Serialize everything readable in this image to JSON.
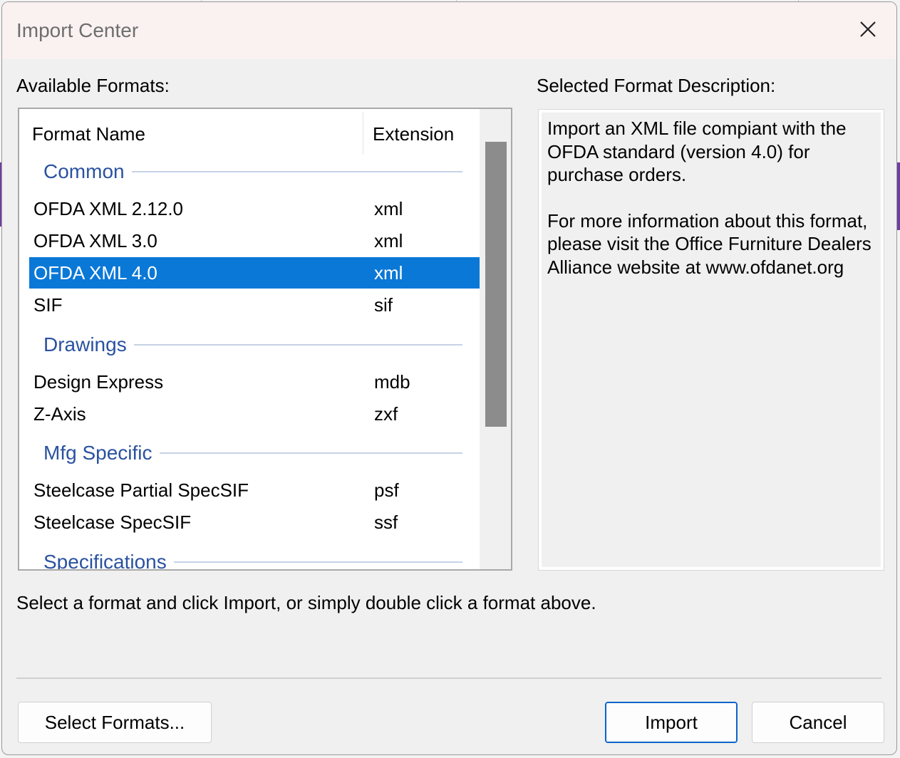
{
  "dialog": {
    "title": "Import Center"
  },
  "formats_panel": {
    "label": "Available Formats:",
    "columns": {
      "name": "Format Name",
      "extension": "Extension"
    },
    "groups": [
      {
        "name": "Common",
        "rows": [
          {
            "name": "OFDA XML 2.12.0",
            "ext": "xml",
            "selected": false
          },
          {
            "name": "OFDA XML 3.0",
            "ext": "xml",
            "selected": false
          },
          {
            "name": "OFDA XML 4.0",
            "ext": "xml",
            "selected": true
          },
          {
            "name": "SIF",
            "ext": "sif",
            "selected": false
          }
        ]
      },
      {
        "name": "Drawings",
        "rows": [
          {
            "name": "Design Express",
            "ext": "mdb",
            "selected": false
          },
          {
            "name": "Z-Axis",
            "ext": "zxf",
            "selected": false
          }
        ]
      },
      {
        "name": "Mfg Specific",
        "rows": [
          {
            "name": "Steelcase Partial SpecSIF",
            "ext": "psf",
            "selected": false
          },
          {
            "name": "Steelcase SpecSIF",
            "ext": "ssf",
            "selected": false
          }
        ]
      },
      {
        "name": "Specifications",
        "rows": []
      }
    ]
  },
  "description_panel": {
    "label": "Selected Format Description:",
    "paragraph1": "Import an XML file compiant with the OFDA standard (version 4.0) for purchase orders.",
    "paragraph2": "For more information about this format, please visit the Office Furniture Dealers Alliance website at www.ofdanet.org"
  },
  "hint": "Select a format and click Import, or simply double click a format above.",
  "buttons": {
    "select_formats": "Select Formats...",
    "import": "Import",
    "cancel": "Cancel"
  },
  "colors": {
    "selection": "#0a78d7",
    "group_heading": "#2a52a0"
  }
}
